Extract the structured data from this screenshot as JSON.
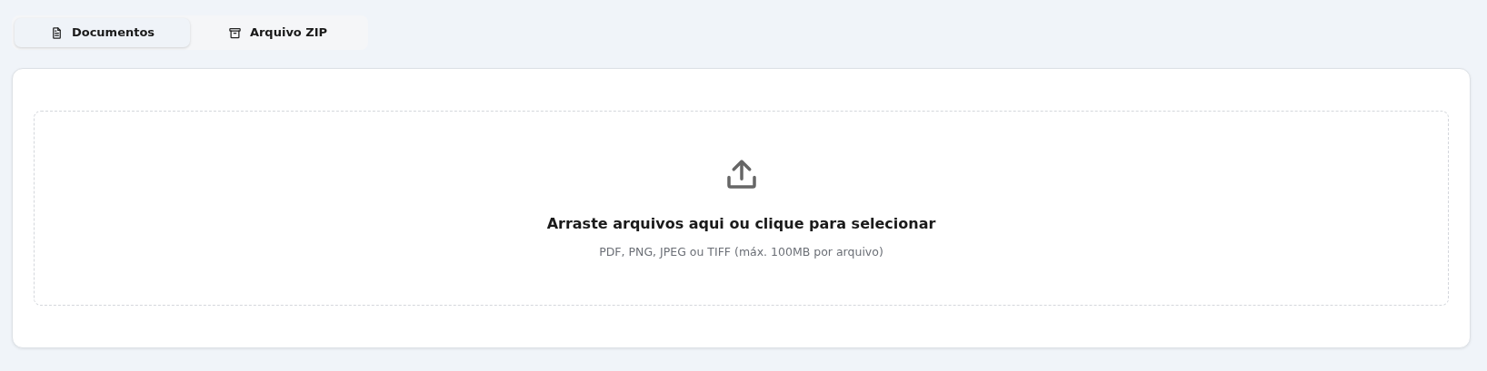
{
  "tabs": [
    {
      "label": "Documentos",
      "kind": "document",
      "selected": true
    },
    {
      "label": "Arquivo ZIP",
      "kind": "archive",
      "selected": false
    }
  ],
  "dropzone": {
    "title": "Arraste arquivos aqui ou clique para selecionar",
    "hint": "PDF, PNG, JPEG ou TIFF (máx. 100MB por arquivo)"
  }
}
